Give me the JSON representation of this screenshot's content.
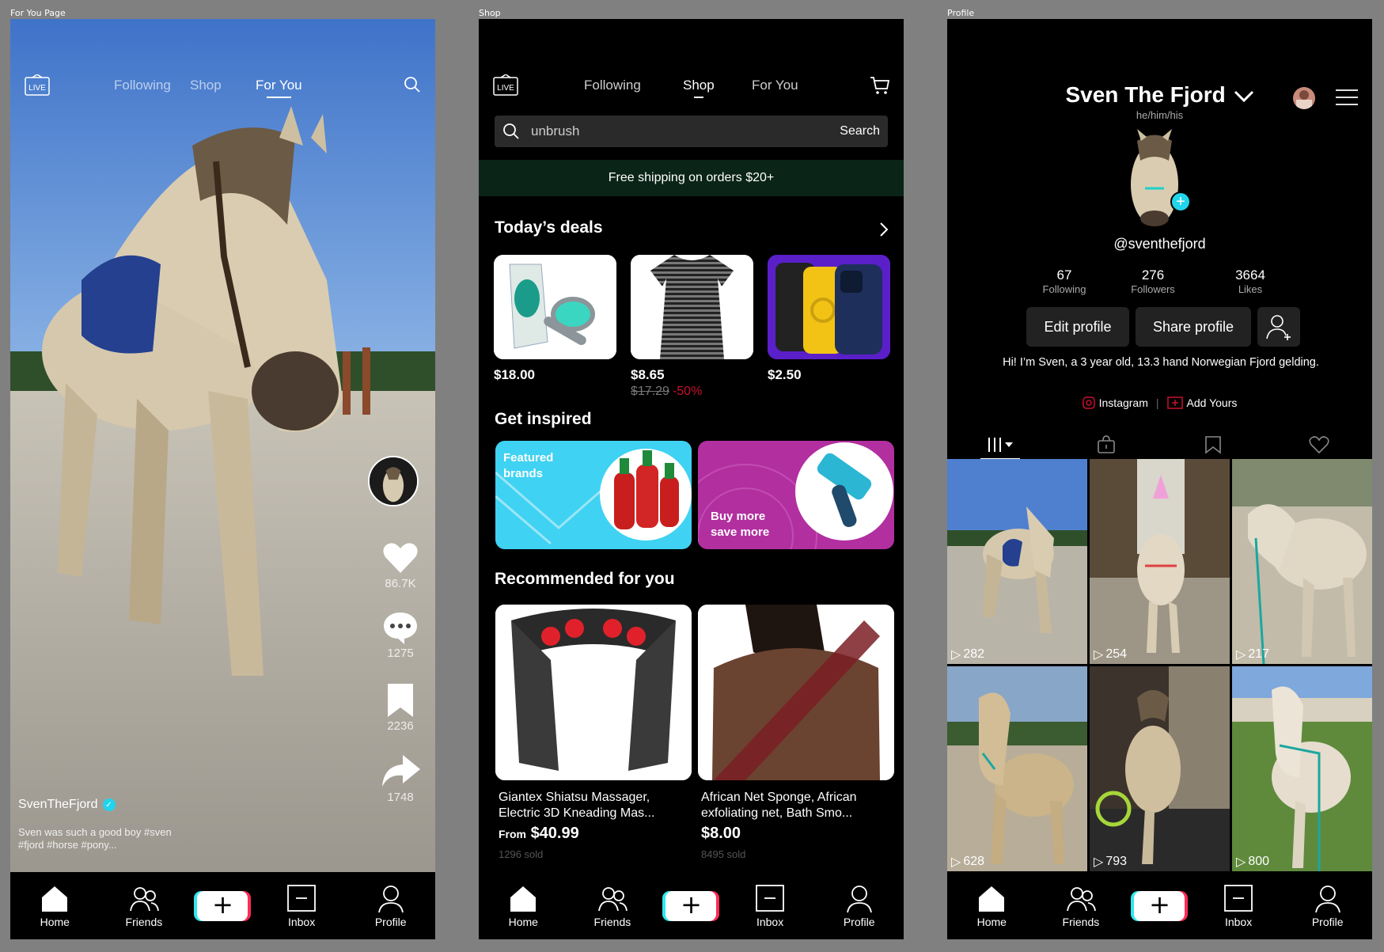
{
  "frames": {
    "foryou_label": "For You Page",
    "shop_label": "Shop",
    "profile_label": "Profile"
  },
  "nav": {
    "home": "Home",
    "friends": "Friends",
    "inbox": "Inbox",
    "profile": "Profile",
    "create": "+"
  },
  "live_label": "LIVE",
  "foryou": {
    "tabs": [
      "Following",
      "Shop",
      "For You"
    ],
    "likes": "86.7K",
    "comments": "1275",
    "saves": "2236",
    "shares": "1748",
    "username": "SvenTheFjord",
    "caption": "Sven was such a good boy #sven #fjord #horse #pony..."
  },
  "shop": {
    "tabs": [
      "Following",
      "Shop",
      "For You"
    ],
    "search_value": "unbrush",
    "search_button": "Search",
    "promo": "Free shipping on orders $20+",
    "todays_deals": "Today’s deals",
    "deals": [
      {
        "price": "$18.00"
      },
      {
        "price": "$8.65",
        "old_price": "$17.29",
        "discount": "-50%"
      },
      {
        "price": "$2.50"
      }
    ],
    "get_inspired": "Get inspired",
    "inspire_featured": "Featured brands",
    "inspire_buy": "Buy more save more",
    "recommended": "Recommended for you",
    "recs": [
      {
        "title": "Giantex Shiatsu Massager, Electric 3D Kneading Mas...",
        "from": "From",
        "price": "$40.99",
        "sold": "1296 sold"
      },
      {
        "title": "African Net Sponge, African exfoliating net, Bath Smo...",
        "price": "$8.00",
        "sold": "8495 sold"
      }
    ]
  },
  "profile": {
    "name": "Sven The Fjord",
    "pronouns": "he/him/his",
    "handle": "@sventhefjord",
    "following_count": "67",
    "following_label": "Following",
    "followers_count": "276",
    "followers_label": "Followers",
    "likes_count": "3664",
    "likes_label": "Likes",
    "edit_button": "Edit profile",
    "share_button": "Share profile",
    "bio": "Hi! I’m Sven, a 3 year old, 13.3 hand Norwegian Fjord gelding.",
    "instagram": "Instagram",
    "add_yours": "Add Yours",
    "videos": [
      {
        "views": "282"
      },
      {
        "views": "254"
      },
      {
        "views": "217"
      },
      {
        "views": "628"
      },
      {
        "views": "793"
      },
      {
        "views": "800"
      }
    ]
  },
  "colors": {
    "accent_cyan": "#2fe7f0",
    "accent_red": "#fe2c55",
    "promo_bg": "#0b2418",
    "discount_red": "#c8102e",
    "featured_bg": "#3fd2f2",
    "buymore_bg": "#b22fa0"
  }
}
